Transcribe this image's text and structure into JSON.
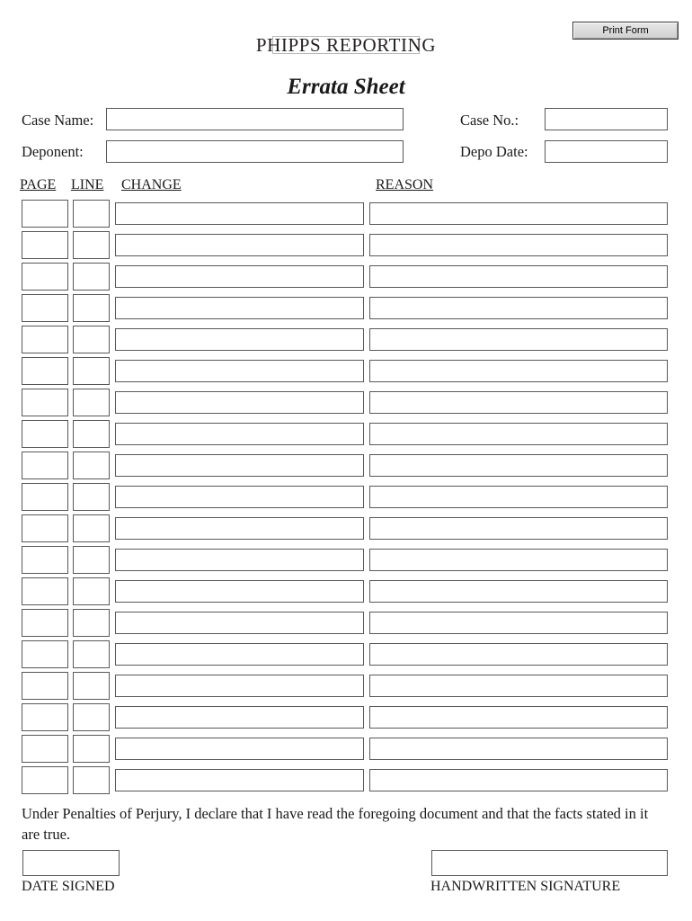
{
  "toolbar": {
    "print_form_label": "Print Form"
  },
  "masthead": {
    "company": "PHIPPS REPORTING",
    "title": "Errata Sheet"
  },
  "fields": {
    "case_name": {
      "label": "Case Name:",
      "value": "",
      "placeholder": ""
    },
    "deponent": {
      "label": "Deponent:",
      "value": "",
      "placeholder": ""
    },
    "case_no": {
      "label": "Case No.:",
      "value": "",
      "placeholder": ""
    },
    "depo_date": {
      "label": "Depo Date:",
      "value": "",
      "placeholder": ""
    }
  },
  "table": {
    "columns": [
      "PAGE",
      "LINE",
      "CHANGE",
      "REASON"
    ],
    "row_count": 19,
    "rows": [
      {
        "page": "",
        "line": "",
        "change": "",
        "reason": ""
      },
      {
        "page": "",
        "line": "",
        "change": "",
        "reason": ""
      },
      {
        "page": "",
        "line": "",
        "change": "",
        "reason": ""
      },
      {
        "page": "",
        "line": "",
        "change": "",
        "reason": ""
      },
      {
        "page": "",
        "line": "",
        "change": "",
        "reason": ""
      },
      {
        "page": "",
        "line": "",
        "change": "",
        "reason": ""
      },
      {
        "page": "",
        "line": "",
        "change": "",
        "reason": ""
      },
      {
        "page": "",
        "line": "",
        "change": "",
        "reason": ""
      },
      {
        "page": "",
        "line": "",
        "change": "",
        "reason": ""
      },
      {
        "page": "",
        "line": "",
        "change": "",
        "reason": ""
      },
      {
        "page": "",
        "line": "",
        "change": "",
        "reason": ""
      },
      {
        "page": "",
        "line": "",
        "change": "",
        "reason": ""
      },
      {
        "page": "",
        "line": "",
        "change": "",
        "reason": ""
      },
      {
        "page": "",
        "line": "",
        "change": "",
        "reason": ""
      },
      {
        "page": "",
        "line": "",
        "change": "",
        "reason": ""
      },
      {
        "page": "",
        "line": "",
        "change": "",
        "reason": ""
      },
      {
        "page": "",
        "line": "",
        "change": "",
        "reason": ""
      },
      {
        "page": "",
        "line": "",
        "change": "",
        "reason": ""
      },
      {
        "page": "",
        "line": "",
        "change": "",
        "reason": ""
      }
    ]
  },
  "declaration": {
    "text": "Under Penalties of Perjury, I declare that I have read the foregoing document and that the facts stated in it are true."
  },
  "signature": {
    "date_signed_label": "DATE SIGNED",
    "date_signed_value": "",
    "handwritten_signature_label": "HANDWRITTEN SIGNATURE",
    "handwritten_signature_value": ""
  },
  "colors": {
    "text": "#1a1a1a",
    "field_border": "#585858",
    "logo_box_border": "#b9b9b9",
    "button_border": "#3a3a3a"
  }
}
